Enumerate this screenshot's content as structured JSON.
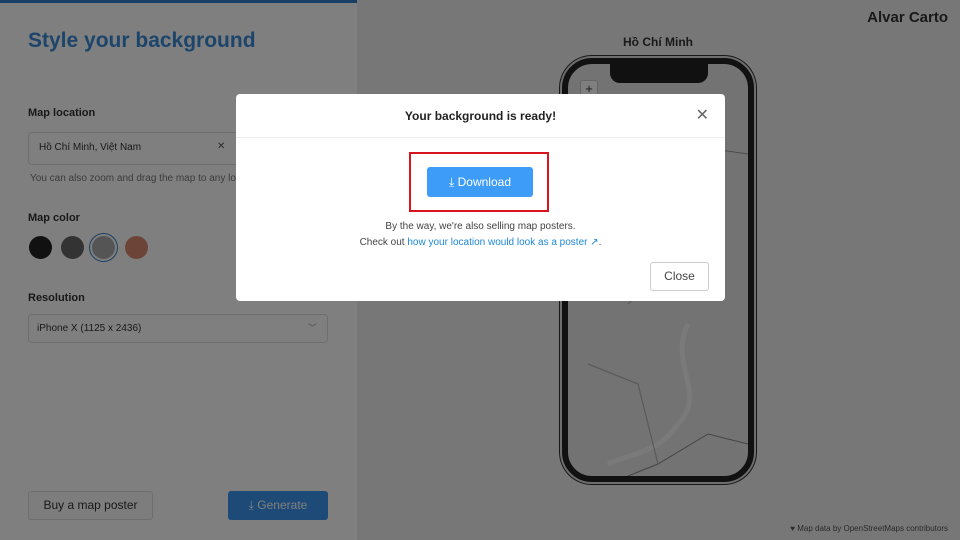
{
  "sidebar": {
    "title": "Style your background",
    "location_label": "Map location",
    "location_value": "Hồ Chí Minh, Việt Nam",
    "location_hint": "You can also zoom and drag the map to any location",
    "color_label": "Map color",
    "colors": [
      "#222222",
      "#666666",
      "#aaaaaa",
      "#d98a70"
    ],
    "selected_color": 2,
    "resolution_label": "Resolution",
    "resolution_value": "iPhone X (1125 x 2436)",
    "buy_label": "Buy a map poster",
    "generate_label": "Generate"
  },
  "map": {
    "brand": "Alvar Carto",
    "city": "Hồ Chí Minh",
    "zoom_in": "+",
    "credit": "Map data by OpenStreetMaps contributors"
  },
  "modal": {
    "title": "Your background is ready!",
    "download_label": "Download",
    "line1": "By the way, we're also selling map posters.",
    "line2_prefix": "Check out ",
    "link": "how your location would look as a poster",
    "line2_suffix": ".",
    "close_label": "Close"
  }
}
